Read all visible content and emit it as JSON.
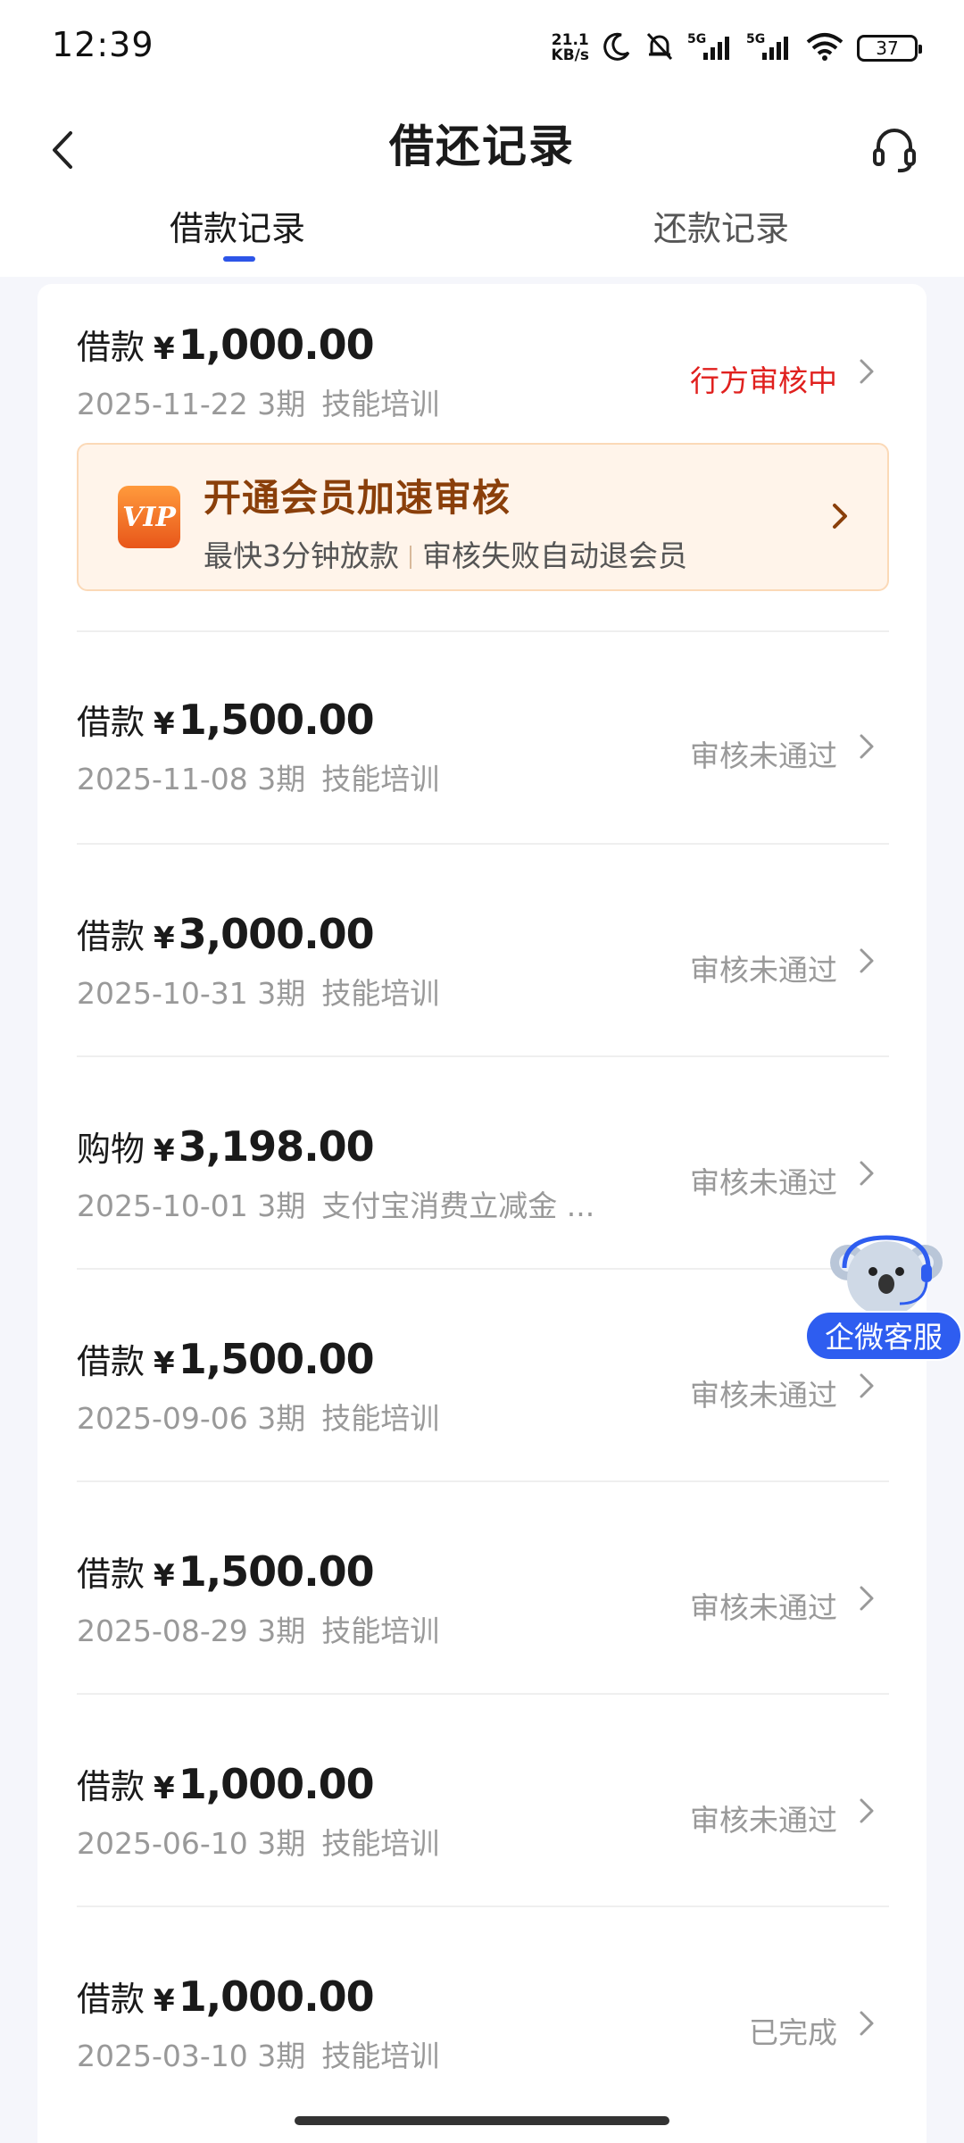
{
  "status_bar": {
    "time": "12:39",
    "net_speed_value": "21.1",
    "net_speed_unit": "KB/s",
    "signal1": "5G",
    "signal2": "5G",
    "battery": "37"
  },
  "nav": {
    "title": "借还记录"
  },
  "tabs": [
    {
      "label": "借款记录",
      "active": true
    },
    {
      "label": "还款记录",
      "active": false
    }
  ],
  "vip_banner": {
    "logo_text": "VIP",
    "title": "开通会员加速审核",
    "sub_left": "最快3分钟放款",
    "sub_right": "审核失败自动退会员"
  },
  "records": [
    {
      "kind": "借款",
      "currency": "¥",
      "amount": "1,000.00",
      "date": "2025-11-22",
      "periods": "3期",
      "purpose": "技能培训",
      "status": "行方审核中"
    },
    {
      "kind": "借款",
      "currency": "¥",
      "amount": "1,500.00",
      "date": "2025-11-08",
      "periods": "3期",
      "purpose": "技能培训",
      "status": "审核未通过"
    },
    {
      "kind": "借款",
      "currency": "¥",
      "amount": "3,000.00",
      "date": "2025-10-31",
      "periods": "3期",
      "purpose": "技能培训",
      "status": "审核未通过"
    },
    {
      "kind": "购物",
      "currency": "¥",
      "amount": "3,198.00",
      "date": "2025-10-01",
      "periods": "3期",
      "purpose": "支付宝消费立减金 ...",
      "status": "审核未通过"
    },
    {
      "kind": "借款",
      "currency": "¥",
      "amount": "1,500.00",
      "date": "2025-09-06",
      "periods": "3期",
      "purpose": "技能培训",
      "status": "审核未通过"
    },
    {
      "kind": "借款",
      "currency": "¥",
      "amount": "1,500.00",
      "date": "2025-08-29",
      "periods": "3期",
      "purpose": "技能培训",
      "status": "审核未通过"
    },
    {
      "kind": "借款",
      "currency": "¥",
      "amount": "1,000.00",
      "date": "2025-06-10",
      "periods": "3期",
      "purpose": "技能培训",
      "status": "审核未通过"
    },
    {
      "kind": "借款",
      "currency": "¥",
      "amount": "1,000.00",
      "date": "2025-03-10",
      "periods": "3期",
      "purpose": "技能培训",
      "status": "已完成"
    }
  ],
  "float_service": {
    "label": "企微客服"
  },
  "colors": {
    "accent": "#2d55e8",
    "pending_status": "#e0201e",
    "muted_status": "#999999",
    "vip_title": "#8a3f0a",
    "float_label_bg": "#2e5df0"
  }
}
